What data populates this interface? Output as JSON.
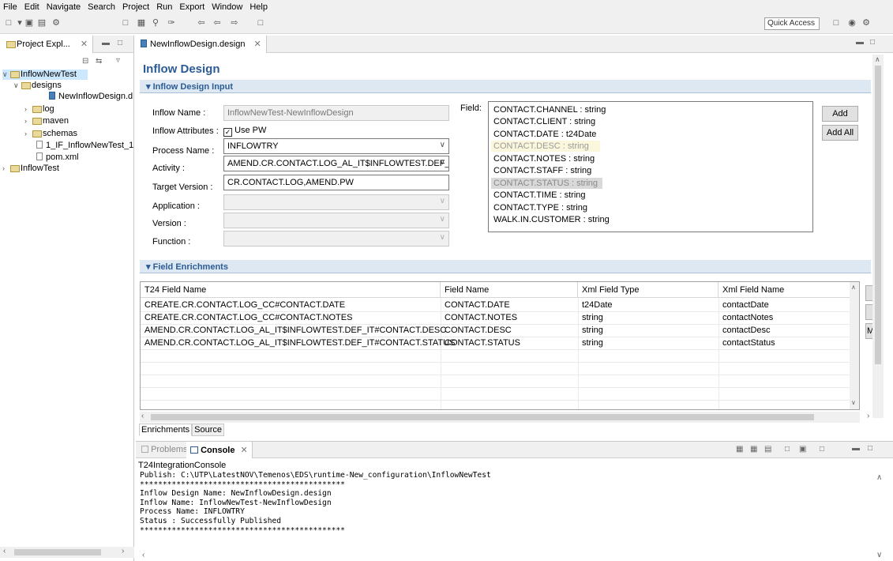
{
  "menu": [
    "File",
    "Edit",
    "Navigate",
    "Search",
    "Project",
    "Run",
    "Export",
    "Window",
    "Help"
  ],
  "toolbar": {
    "quick_access": "Quick Access"
  },
  "project_explorer": {
    "tab_label": "Project Expl...",
    "tree": [
      {
        "label": "InflowNewTest",
        "level": 0,
        "kind": "project",
        "expanded": true
      },
      {
        "label": "designs",
        "level": 1,
        "kind": "folder",
        "expanded": true
      },
      {
        "label": "NewInflowDesign.d",
        "level": 2,
        "kind": "design"
      },
      {
        "label": "log",
        "level": 1,
        "kind": "folder"
      },
      {
        "label": "maven",
        "level": 1,
        "kind": "folder"
      },
      {
        "label": "schemas",
        "level": 1,
        "kind": "folder"
      },
      {
        "label": "1_IF_InflowNewTest_1",
        "level": 1,
        "kind": "file"
      },
      {
        "label": "pom.xml",
        "level": 1,
        "kind": "file"
      },
      {
        "label": "InflowTest",
        "level": 0,
        "kind": "project"
      }
    ]
  },
  "editor": {
    "tab_label": "NewInflowDesign.design",
    "title": "Inflow Design",
    "section_input": "Inflow Design Input",
    "section_enrich": "Field Enrichments",
    "form": {
      "inflow_name_label": "Inflow Name :",
      "inflow_name_value": "InflowNewTest-NewInflowDesign",
      "inflow_attr_label": "Inflow Attributes :",
      "use_pw_label": "Use PW",
      "process_name_label": "Process Name :",
      "process_name_value": "INFLOWTRY",
      "activity_label": "Activity :",
      "activity_value": "AMEND.CR.CONTACT.LOG_AL_IT$INFLOWTEST.DEF_IT",
      "target_version_label": "Target Version :",
      "target_version_value": "CR.CONTACT.LOG,AMEND.PW",
      "application_label": "Application :",
      "version_label": "Version :",
      "function_label": "Function :"
    },
    "field_label": "Field:",
    "fields": [
      {
        "text": "CONTACT.CHANNEL : string",
        "state": "normal"
      },
      {
        "text": "CONTACT.CLIENT : string",
        "state": "normal"
      },
      {
        "text": "CONTACT.DATE : t24Date",
        "state": "normal"
      },
      {
        "text": "CONTACT.DESC : string",
        "state": "used"
      },
      {
        "text": "CONTACT.NOTES : string",
        "state": "normal"
      },
      {
        "text": "CONTACT.STAFF : string",
        "state": "normal"
      },
      {
        "text": "CONTACT.STATUS : string",
        "state": "selected"
      },
      {
        "text": "CONTACT.TIME : string",
        "state": "normal"
      },
      {
        "text": "CONTACT.TYPE : string",
        "state": "normal"
      },
      {
        "text": "WALK.IN.CUSTOMER : string",
        "state": "normal"
      }
    ],
    "buttons": {
      "add": "Add",
      "add_all": "Add All",
      "side_m": "M"
    },
    "table": {
      "headers": [
        "T24 Field Name",
        "Field Name",
        "Xml Field Type",
        "Xml Field Name"
      ],
      "rows": [
        [
          "CREATE.CR.CONTACT.LOG_CC#CONTACT.DATE",
          "CONTACT.DATE",
          "t24Date",
          "contactDate"
        ],
        [
          "CREATE.CR.CONTACT.LOG_CC#CONTACT.NOTES",
          "CONTACT.NOTES",
          "string",
          "contactNotes"
        ],
        [
          "AMEND.CR.CONTACT.LOG_AL_IT$INFLOWTEST.DEF_IT#CONTACT.DESC",
          "CONTACT.DESC",
          "string",
          "contactDesc"
        ],
        [
          "AMEND.CR.CONTACT.LOG_AL_IT$INFLOWTEST.DEF_IT#CONTACT.STATUS",
          "CONTACT.STATUS",
          "string",
          "contactStatus"
        ]
      ]
    },
    "subtabs": [
      "Enrichments",
      "Source"
    ]
  },
  "console": {
    "tabs": [
      "Problems",
      "Console"
    ],
    "name": "T24IntegrationConsole",
    "lines": [
      "Publish: C:\\UTP\\LatestNOV\\Temenos\\EDS\\runtime-New_configuration\\InflowNewTest",
      "*********************************************",
      "Inflow Design Name: NewInflowDesign.design",
      "Inflow Name: InflowNewTest-NewInflowDesign",
      "Process Name: INFLOWTRY",
      "Status : Successfully Published",
      "*********************************************"
    ]
  },
  "colors": {
    "section_bg": "#dde8f3",
    "title": "#2c5c94",
    "used_bg": "#fbf7dd",
    "selected_bg": "#d9d9d9"
  }
}
